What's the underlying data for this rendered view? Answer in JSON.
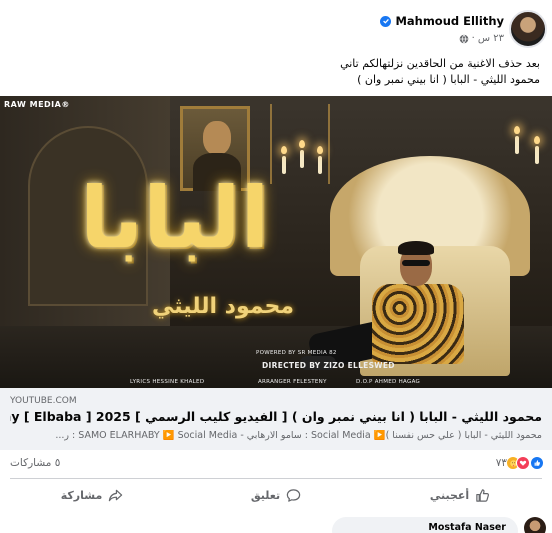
{
  "post": {
    "author": "Mahmoud Ellithy",
    "time": "٢٣ س",
    "separator": "·",
    "caption_line1": "بعد حذف الاغنية من الحاقدين نزلتهالكم تاني",
    "caption_line2": "محمود الليثي - البابا ( انا بيني نمبر وان )"
  },
  "thumbnail": {
    "brand": "RAW MEDIA®",
    "title_art": "البابا",
    "subtitle_art": "محمود الليثي",
    "powered_by": "POWERED BY SR MEDIA 82",
    "director": "DIRECTED BY  ZIZO ELLESWED",
    "lyrics": "LYRICS  HESSINE KHALED",
    "arranger": "ARRANGER  FELESTENY",
    "dop": "D.O.P  AHMED HAGAG"
  },
  "link": {
    "domain": "YOUTUBE.COM",
    "title": "محمود الليثي - البابا ( انا بيني نمبر وان ) [ الفيديو كليب الرسمي ] 2025 [ Mahmoud ElLaithy [ Elbaba",
    "description": "محمود الليثي - البابا ( علي حس نفسنا )▶️ Social Media : سامو الارهابي - SAMO ELARHABY ▶️ Social Media : ر..."
  },
  "stats": {
    "reactions_count": "٧٣",
    "shares": "٥ مشاركات"
  },
  "actions": {
    "like": "أعجبني",
    "comment": "تعليق",
    "share": "مشاركة"
  },
  "comment": {
    "author": "Mostafa Naser"
  },
  "colors": {
    "accent": "#1877f2",
    "secondary_text": "#65676b",
    "link_bg": "#f0f2f5"
  }
}
